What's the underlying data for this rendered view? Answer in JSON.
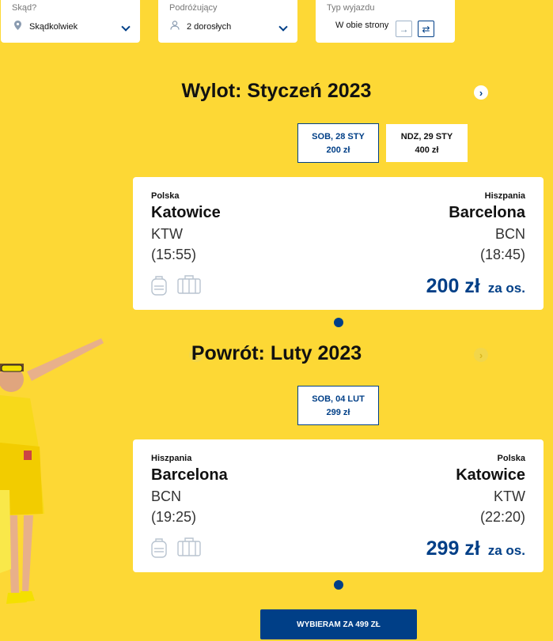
{
  "filters": {
    "from": {
      "label": "Skąd?",
      "value": "Skądkolwiek",
      "icon": "location-pin-icon"
    },
    "travelers": {
      "label": "Podróżujący",
      "value": "2 dorosłych",
      "icon": "person-icon"
    },
    "trip_type": {
      "label": "Typ wyjazdu",
      "value": "W obie strony"
    }
  },
  "outbound": {
    "heading": "Wylot: Styczeń 2023",
    "dates": [
      {
        "day": "SOB, 28 STY",
        "price": "200 zł",
        "selected": true
      },
      {
        "day": "NDZ, 29 STY",
        "price": "400 zł",
        "selected": false
      }
    ],
    "flight": {
      "from_country": "Polska",
      "from_city": "Katowice",
      "from_code": "KTW",
      "from_time": "(15:55)",
      "to_country": "Hiszpania",
      "to_city": "Barcelona",
      "to_code": "BCN",
      "to_time": "(18:45)",
      "price": "200 zł",
      "per": "za os."
    }
  },
  "return": {
    "heading": "Powrót: Luty 2023",
    "dates": [
      {
        "day": "SOB, 04 LUT",
        "price": "299 zł",
        "selected": true
      }
    ],
    "flight": {
      "from_country": "Hiszpania",
      "from_city": "Barcelona",
      "from_code": "BCN",
      "from_time": "(19:25)",
      "to_country": "Polska",
      "to_city": "Katowice",
      "to_code": "KTW",
      "to_time": "(22:20)",
      "price": "299 zł",
      "per": "za os."
    }
  },
  "cta": {
    "label": "WYBIERAM ZA 499 ZŁ"
  },
  "colors": {
    "background": "#fdd835",
    "accent": "#003f87"
  }
}
